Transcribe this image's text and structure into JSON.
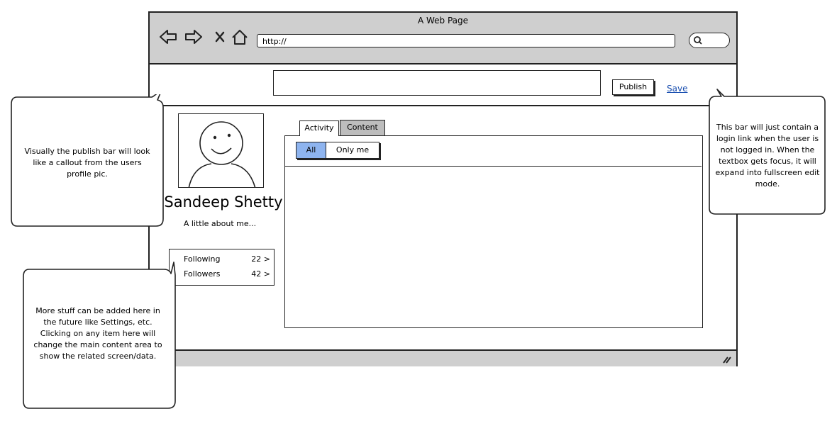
{
  "browser": {
    "title": "A Web Page",
    "url": "http://"
  },
  "publish_bar": {
    "publish_label": "Publish",
    "save_label": "Save"
  },
  "profile": {
    "name": "Sandeep Shetty",
    "about": "A little about me...",
    "stats": [
      {
        "label": "Following",
        "value": "22 >"
      },
      {
        "label": "Followers",
        "value": "42 >"
      }
    ]
  },
  "tabs": [
    {
      "label": "Activity",
      "selected": true
    },
    {
      "label": "Content",
      "selected": false
    }
  ],
  "filter": {
    "options": [
      "All",
      "Only me"
    ],
    "selected": "All"
  },
  "callouts": {
    "left_top": "Visually the publish bar will look like a callout from the users profile pic.",
    "left_bottom": "More stuff can be added here in the future like Settings, etc. Clicking on any item here will change the main content area to show the related screen/data.",
    "right": "This bar will just contain a login link when the user is not logged in. When the textbox gets focus, it will expand into fullscreen edit mode."
  },
  "colors": {
    "selected_filter": "#8eb4ef",
    "chrome": "#cfcfcf",
    "link": "#1a4fb0"
  },
  "icons": [
    "back-icon",
    "forward-icon",
    "stop-icon",
    "home-icon",
    "search-icon",
    "resize-grip-icon",
    "smiley-avatar-icon"
  ]
}
